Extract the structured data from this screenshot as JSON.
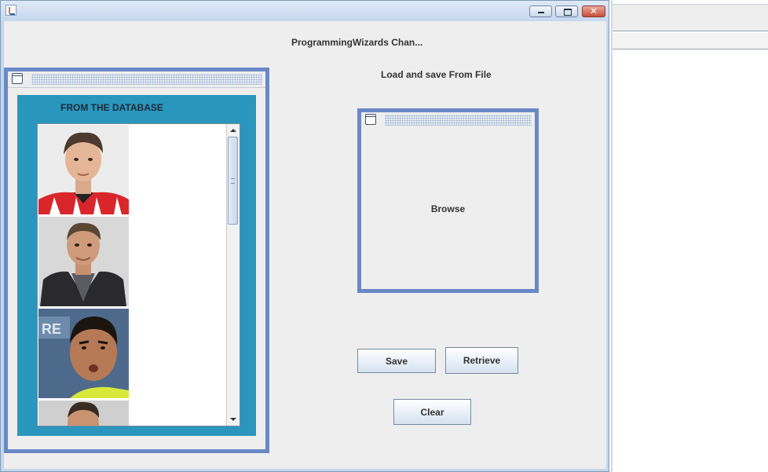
{
  "window": {
    "title": "ProgrammingWizards Chan...",
    "controls": {
      "minimize": "minimize-icon",
      "maximize": "maximize-icon",
      "close": "close-icon"
    }
  },
  "database_frame": {
    "title": "FROM THE DATABASE",
    "photos": [
      {
        "name": "player-photo-1"
      },
      {
        "name": "player-photo-2"
      },
      {
        "name": "player-photo-3"
      },
      {
        "name": "player-photo-4"
      }
    ]
  },
  "file_section": {
    "title": "Load and save From File",
    "browse_label": "Browse"
  },
  "buttons": {
    "save": "Save",
    "retrieve": "Retrieve",
    "clear": "Clear"
  },
  "colors": {
    "frame_border": "#6a88c6",
    "db_panel": "#2a96bd",
    "content_bg": "#eeeeee"
  }
}
